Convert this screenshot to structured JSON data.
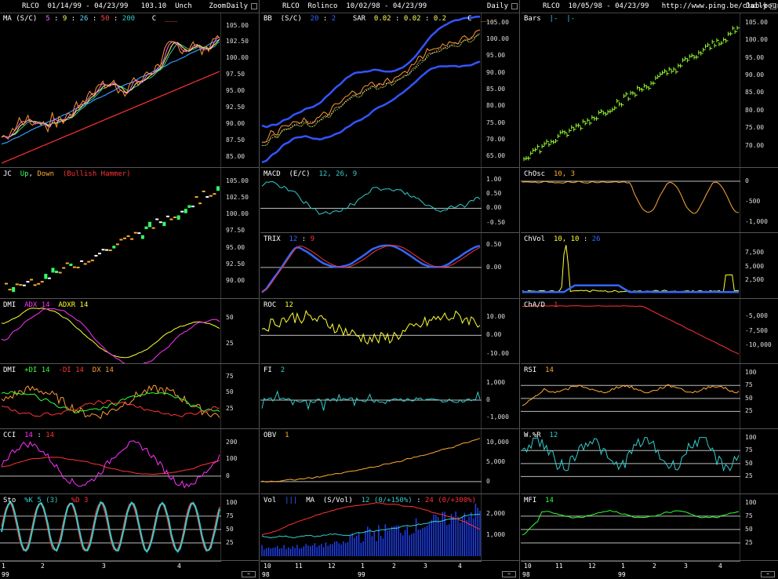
{
  "columns": [
    {
      "id": "left",
      "header": {
        "text": "RLCO  01/14/99 - 04/23/99   103.10  Unch    Zoom",
        "daily": "Daily"
      },
      "panels": [
        {
          "id": "ma",
          "title": [
            {
              "t": "MA (S/C)  ",
              "c": "#ffffff"
            },
            {
              "t": "5",
              "c": "#ff66ff"
            },
            {
              "t": " : ",
              "c": "#ffffff"
            },
            {
              "t": "9",
              "c": "#ffff66"
            },
            {
              "t": " : ",
              "c": "#ffffff"
            },
            {
              "t": "26",
              "c": "#66ccff"
            },
            {
              "t": " : ",
              "c": "#ffffff"
            },
            {
              "t": "50",
              "c": "#ff4444"
            },
            {
              "t": " : ",
              "c": "#ffffff"
            },
            {
              "t": "200",
              "c": "#33cccc"
            },
            {
              "t": "    C  ",
              "c": "#ffffff"
            },
            {
              "t": "___",
              "c": "#ff6633"
            }
          ],
          "yticks": [
            "105.00",
            "102.50",
            "100.00",
            "97.50",
            "95.00",
            "92.50",
            "90.00",
            "87.50",
            "85.00"
          ],
          "ymin": 84,
          "ymax": 106.5,
          "tickvals": [
            105,
            102.5,
            100,
            97.5,
            95,
            92.5,
            90,
            87.5,
            85
          ]
        },
        {
          "id": "jc",
          "title": [
            {
              "t": "JC  ",
              "c": "#ffffff"
            },
            {
              "t": "Up",
              "c": "#33ff66"
            },
            {
              "t": ", ",
              "c": "#ffffff"
            },
            {
              "t": "Down",
              "c": "#ffaa33"
            },
            {
              "t": "  (Bullish Hammer)",
              "c": "#ff3333"
            }
          ],
          "yticks": [
            "105.00",
            "102.50",
            "100.00",
            "97.50",
            "95.00",
            "92.50",
            "90.00"
          ],
          "ymin": 88,
          "ymax": 106.5,
          "tickvals": [
            105,
            102.5,
            100,
            97.5,
            95,
            92.5,
            90
          ]
        },
        {
          "id": "dmi1",
          "title": [
            {
              "t": "DMI  ",
              "c": "#ffffff"
            },
            {
              "t": "ADX 14",
              "c": "#ff33ff"
            },
            {
              "t": "  ADXR 14",
              "c": "#ffff33"
            }
          ],
          "yticks": [
            "50",
            "25"
          ],
          "ymin": 10,
          "ymax": 65,
          "tickvals": [
            50,
            25
          ]
        },
        {
          "id": "dmi2",
          "title": [
            {
              "t": "DMI  ",
              "c": "#ffffff"
            },
            {
              "t": "+DI 14",
              "c": "#33ff33"
            },
            {
              "t": "  -DI 14",
              "c": "#ff3333"
            },
            {
              "t": "  DX 14",
              "c": "#ff9933"
            }
          ],
          "yticks": [
            "75",
            "50",
            "25"
          ],
          "ymin": 0,
          "ymax": 90,
          "tickvals": [
            75,
            50,
            25
          ]
        },
        {
          "id": "cci",
          "title": [
            {
              "t": "CCI  ",
              "c": "#ffffff"
            },
            {
              "t": "14",
              "c": "#ff33ff"
            },
            {
              "t": " : ",
              "c": "#ffffff"
            },
            {
              "t": "14",
              "c": "#ff3333"
            }
          ],
          "yticks": [
            "200",
            "100",
            "0"
          ],
          "ymin": -80,
          "ymax": 260,
          "tickvals": [
            200,
            100,
            0
          ]
        },
        {
          "id": "sto",
          "title": [
            {
              "t": "Sto  ",
              "c": "#ffffff"
            },
            {
              "t": "%K 5 (3)",
              "c": "#33cccc"
            },
            {
              "t": "   %D 3",
              "c": "#ff3333"
            }
          ],
          "yticks": [
            "100",
            "75",
            "50",
            "25"
          ],
          "ymin": 0,
          "ymax": 110,
          "tickvals": [
            100,
            75,
            50,
            25
          ]
        }
      ],
      "xlabels": [
        "1",
        "2",
        "3",
        "4"
      ],
      "year": "99"
    },
    {
      "id": "mid",
      "header": {
        "text": "RLCO  Rolinco  10/02/98 - 04/23/99",
        "daily": "Daily"
      },
      "panels": [
        {
          "id": "bb",
          "title": [
            {
              "t": "BB  (S/C)  ",
              "c": "#ffffff"
            },
            {
              "t": "20",
              "c": "#3366ff"
            },
            {
              "t": " : ",
              "c": "#ffffff"
            },
            {
              "t": "2",
              "c": "#3366ff"
            },
            {
              "t": "    SAR  ",
              "c": "#ffffff"
            },
            {
              "t": "0.02",
              "c": "#ffff66"
            },
            {
              "t": " : ",
              "c": "#ffffff"
            },
            {
              "t": "0.02",
              "c": "#ffff66"
            },
            {
              "t": " : ",
              "c": "#ffffff"
            },
            {
              "t": "0.2",
              "c": "#ffff66"
            },
            {
              "t": "     C  ",
              "c": "#ffffff"
            },
            {
              "t": "___",
              "c": "#ff9933"
            }
          ],
          "yticks": [
            "105.00",
            "100.00",
            "95.00",
            "90.00",
            "85.00",
            "80.00",
            "75.00",
            "70.00",
            "65.00"
          ],
          "ymin": 63,
          "ymax": 107,
          "tickvals": [
            105,
            100,
            95,
            90,
            85,
            80,
            75,
            70,
            65
          ]
        },
        {
          "id": "macd",
          "title": [
            {
              "t": "MACD  (E/C)  ",
              "c": "#ffffff"
            },
            {
              "t": "12, 26, 9",
              "c": "#33cccc"
            }
          ],
          "yticks": [
            "1.00",
            "0.50",
            "0.00",
            "-0.50"
          ],
          "ymin": -0.7,
          "ymax": 1.3,
          "tickvals": [
            1,
            0.5,
            0,
            -0.5
          ]
        },
        {
          "id": "trix",
          "title": [
            {
              "t": "TRIX  ",
              "c": "#ffffff"
            },
            {
              "t": "12",
              "c": "#3366ff"
            },
            {
              "t": " : ",
              "c": "#ffffff"
            },
            {
              "t": "9",
              "c": "#ff3333"
            }
          ],
          "yticks": [
            "0.50",
            "0.00"
          ],
          "ymin": -0.6,
          "ymax": 0.7,
          "tickvals": [
            0.5,
            0
          ]
        },
        {
          "id": "roc",
          "title": [
            {
              "t": "ROC  ",
              "c": "#ffffff"
            },
            {
              "t": "12",
              "c": "#ffff33"
            }
          ],
          "yticks": [
            "10.00",
            "0.00",
            "-10.00"
          ],
          "ymin": -13,
          "ymax": 18,
          "tickvals": [
            10,
            0,
            -10
          ]
        },
        {
          "id": "fi",
          "title": [
            {
              "t": "FI  ",
              "c": "#ffffff"
            },
            {
              "t": "2",
              "c": "#33cccc"
            }
          ],
          "yticks": [
            "1,000",
            "0",
            "-1,000"
          ],
          "ymin": -1400,
          "ymax": 1900,
          "tickvals": [
            1000,
            0,
            -1000
          ]
        },
        {
          "id": "obv",
          "title": [
            {
              "t": "OBV  ",
              "c": "#ffffff"
            },
            {
              "t": "1",
              "c": "#ffaa33"
            }
          ],
          "yticks": [
            "10,000",
            "5,000",
            "0"
          ],
          "ymin": -2000,
          "ymax": 12500,
          "tickvals": [
            10000,
            5000,
            0
          ]
        },
        {
          "id": "vol",
          "title": [
            {
              "t": "Vol  ",
              "c": "#ffffff"
            },
            {
              "t": "|||",
              "c": "#3366ff"
            },
            {
              "t": "  MA  (S/Vol)  ",
              "c": "#ffffff"
            },
            {
              "t": "12 (0/+150%)",
              "c": "#33cccc"
            },
            {
              "t": " : ",
              "c": "#ffffff"
            },
            {
              "t": "24 (0/+300%)",
              "c": "#ff3333"
            }
          ],
          "yticks": [
            "2,000",
            "1,000"
          ],
          "ymin": 0,
          "ymax": 2800,
          "tickvals": [
            2000,
            1000
          ]
        }
      ],
      "xlabels": [
        "10",
        "11",
        "12",
        "1",
        "2",
        "3",
        "4"
      ],
      "year": "98",
      "year2": "99"
    },
    {
      "id": "right",
      "header": {
        "text": "RLCO  10/05/98 - 04/23/99   http://www.ping.be/club-bourse",
        "daily": "Daily"
      },
      "panels": [
        {
          "id": "bars",
          "title": [
            {
              "t": "Bars  ",
              "c": "#ffffff"
            },
            {
              "t": "|-  |-",
              "c": "#33ccff"
            }
          ],
          "yticks": [
            "105.00",
            "100.00",
            "95.00",
            "90.00",
            "85.00",
            "80.00",
            "75.00",
            "70.00"
          ],
          "ymin": 65,
          "ymax": 107,
          "tickvals": [
            105,
            100,
            95,
            90,
            85,
            80,
            75,
            70
          ]
        },
        {
          "id": "chosc",
          "title": [
            {
              "t": "ChOsc  ",
              "c": "#ffffff"
            },
            {
              "t": "10, 3",
              "c": "#ffaa33"
            }
          ],
          "yticks": [
            "0",
            "-500",
            "-1,000"
          ],
          "ymin": -1150,
          "ymax": 250,
          "tickvals": [
            0,
            -500,
            -1000
          ]
        },
        {
          "id": "chvol",
          "title": [
            {
              "t": "ChVol  ",
              "c": "#ffffff"
            },
            {
              "t": "10, 10",
              "c": "#ffff33"
            },
            {
              "t": " : ",
              "c": "#ffffff"
            },
            {
              "t": "26",
              "c": "#3366ff"
            }
          ],
          "yticks": [
            "7,500",
            "5,000",
            "2,500"
          ],
          "ymin": 0,
          "ymax": 10500,
          "tickvals": [
            7500,
            5000,
            2500
          ]
        },
        {
          "id": "chad",
          "title": [
            {
              "t": "ChA/D  ",
              "c": "#ffffff"
            },
            {
              "t": "1",
              "c": "#ff3333"
            }
          ],
          "yticks": [
            "-5,000",
            "-7,500",
            "-10,000"
          ],
          "ymin": -12500,
          "ymax": -2500,
          "tickvals": [
            -5000,
            -7500,
            -10000
          ]
        },
        {
          "id": "rsi",
          "title": [
            {
              "t": "RSI  ",
              "c": "#ffffff"
            },
            {
              "t": "14",
              "c": "#ffaa33"
            }
          ],
          "yticks": [
            "100",
            "75",
            "50",
            "25"
          ],
          "ymin": 0,
          "ymax": 110,
          "tickvals": [
            100,
            75,
            50,
            25
          ]
        },
        {
          "id": "wr",
          "title": [
            {
              "t": "W.%R  ",
              "c": "#ffffff"
            },
            {
              "t": "12",
              "c": "#33cccc"
            }
          ],
          "yticks": [
            "100",
            "75",
            "50",
            "25"
          ],
          "ymin": 0,
          "ymax": 110,
          "tickvals": [
            100,
            75,
            50,
            25
          ]
        },
        {
          "id": "mfi",
          "title": [
            {
              "t": "MFI  ",
              "c": "#ffffff"
            },
            {
              "t": "14",
              "c": "#33ff33"
            }
          ],
          "yticks": [
            "100",
            "75",
            "50",
            "25"
          ],
          "ymin": 0,
          "ymax": 110,
          "tickvals": [
            100,
            75,
            50,
            25
          ]
        }
      ],
      "xlabels": [
        "10",
        "11",
        "12",
        "1",
        "2",
        "3",
        "4"
      ],
      "year": "98",
      "year2": "99"
    }
  ]
}
